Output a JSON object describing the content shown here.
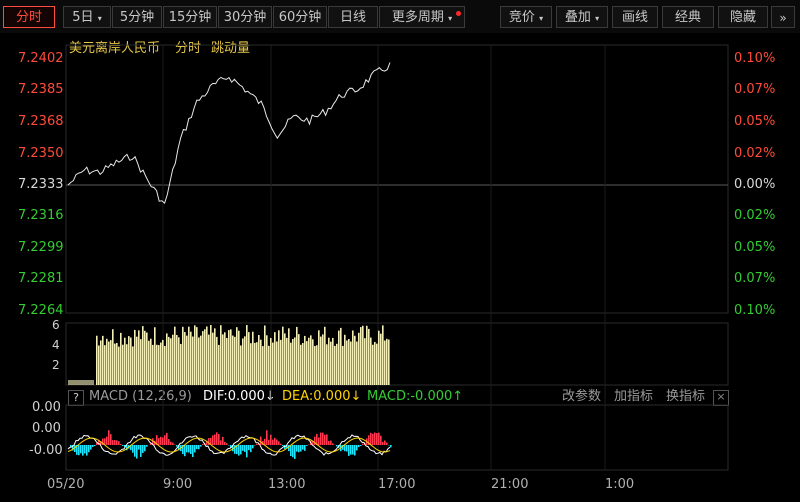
{
  "toolbar": {
    "tabs": [
      {
        "label": "分时",
        "active": true
      },
      {
        "label": "5日",
        "dropdown": true
      },
      {
        "label": "5分钟"
      },
      {
        "label": "15分钟"
      },
      {
        "label": "30分钟"
      },
      {
        "label": "60分钟"
      },
      {
        "label": "日线"
      },
      {
        "label": "更多周期",
        "dropdown": true,
        "notify": true
      }
    ],
    "right_buttons": [
      {
        "label": "竞价",
        "dropdown": true
      },
      {
        "label": "叠加",
        "dropdown": true
      },
      {
        "label": "画线"
      },
      {
        "label": "经典"
      },
      {
        "label": "隐藏"
      }
    ],
    "expand_icon": "double-chevron-right-icon"
  },
  "header": {
    "symbol": "美元离岸人民币",
    "mode": "分时",
    "indicator": "跳动量"
  },
  "price_axis": {
    "prices": [
      "7.2402",
      "7.2385",
      "7.2368",
      "7.2350",
      "7.2333",
      "7.2316",
      "7.2299",
      "7.2281",
      "7.2264"
    ],
    "percents": [
      "0.10%",
      "0.07%",
      "0.05%",
      "0.02%",
      "0.00%",
      "0.02%",
      "0.05%",
      "0.07%",
      "0.10%"
    ],
    "up_color": "#ff4b3a",
    "down_color": "#33cc33"
  },
  "volume_axis": [
    "6",
    "4",
    "2"
  ],
  "macd": {
    "help": "?",
    "name": "MACD (12,26,9)",
    "dif": "DIF:0.000↓",
    "dea": "DEA:0.000↓",
    "macd": "MACD:-0.000↑",
    "buttons": [
      "改参数",
      "加指标",
      "换指标"
    ],
    "close_icon": "close-icon",
    "axis": [
      "0.00",
      "0.00",
      "-0.00"
    ]
  },
  "time_axis": [
    "05/20",
    "9:00",
    "13:00",
    "17:00",
    "21:00",
    "1:00"
  ],
  "chart_data": {
    "type": "line",
    "title": "美元离岸人民币",
    "subtitle": "分时",
    "base_price": 7.2333,
    "y_range": [
      7.2264,
      7.2402
    ],
    "x_ticks": [
      "05/20",
      "9:00",
      "13:00",
      "17:00",
      "21:00",
      "1:00"
    ],
    "series": [
      {
        "points": [
          [
            "05/20 05:00",
            7.2333
          ],
          [
            "06:00",
            7.2341
          ],
          [
            "07:00",
            7.234
          ],
          [
            "08:00",
            7.2345
          ],
          [
            "08:30",
            7.2349
          ],
          [
            "09:00",
            7.2335
          ],
          [
            "09:30",
            7.2322
          ],
          [
            "10:00",
            7.2358
          ],
          [
            "10:30",
            7.2378
          ],
          [
            "11:00",
            7.2387
          ],
          [
            "11:30",
            7.2392
          ],
          [
            "12:00",
            7.2385
          ],
          [
            "12:30",
            7.2377
          ],
          [
            "13:00",
            7.236
          ],
          [
            "13:30",
            7.237
          ],
          [
            "14:00",
            7.2368
          ],
          [
            "14:30",
            7.2373
          ],
          [
            "15:00",
            7.2382
          ],
          [
            "15:30",
            7.2385
          ],
          [
            "16:00",
            7.2393
          ],
          [
            "16:30",
            7.2398
          ]
        ]
      }
    ],
    "volume": {
      "type": "bar",
      "ylim": [
        0,
        6
      ],
      "range": [
        "05/20 05:00",
        "16:30"
      ],
      "typical": 4.5
    },
    "macd": {
      "type": "bar+line",
      "lines": [
        "DIF",
        "DEA"
      ],
      "values": {
        "DIF": 0.0,
        "DEA": 0.0,
        "MACD": -0.0
      }
    }
  }
}
